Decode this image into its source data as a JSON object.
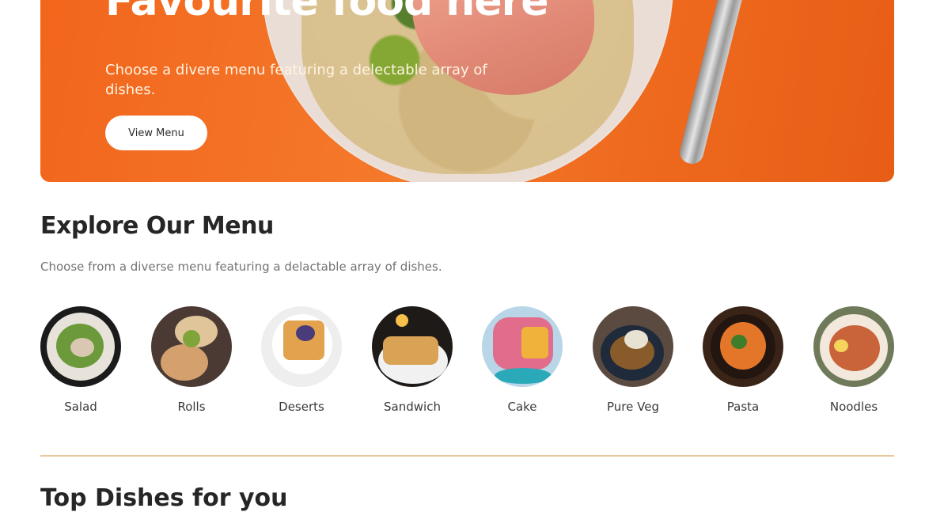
{
  "hero": {
    "title": "Favourite food here",
    "text": "Choose a divere menu featuring a delectable array of dishes.",
    "button_label": "View Menu"
  },
  "explore": {
    "title": "Explore Our Menu",
    "text": "Choose from a diverse menu featuring a delactable array of dishes."
  },
  "menu_items": [
    {
      "label": "Salad"
    },
    {
      "label": "Rolls"
    },
    {
      "label": "Deserts"
    },
    {
      "label": "Sandwich"
    },
    {
      "label": "Cake"
    },
    {
      "label": "Pure Veg"
    },
    {
      "label": "Pasta"
    },
    {
      "label": "Noodles"
    }
  ],
  "next_section": {
    "title": "Top Dishes for you"
  },
  "colors": {
    "accent": "#f2651c",
    "divider": "#e9c79b"
  }
}
